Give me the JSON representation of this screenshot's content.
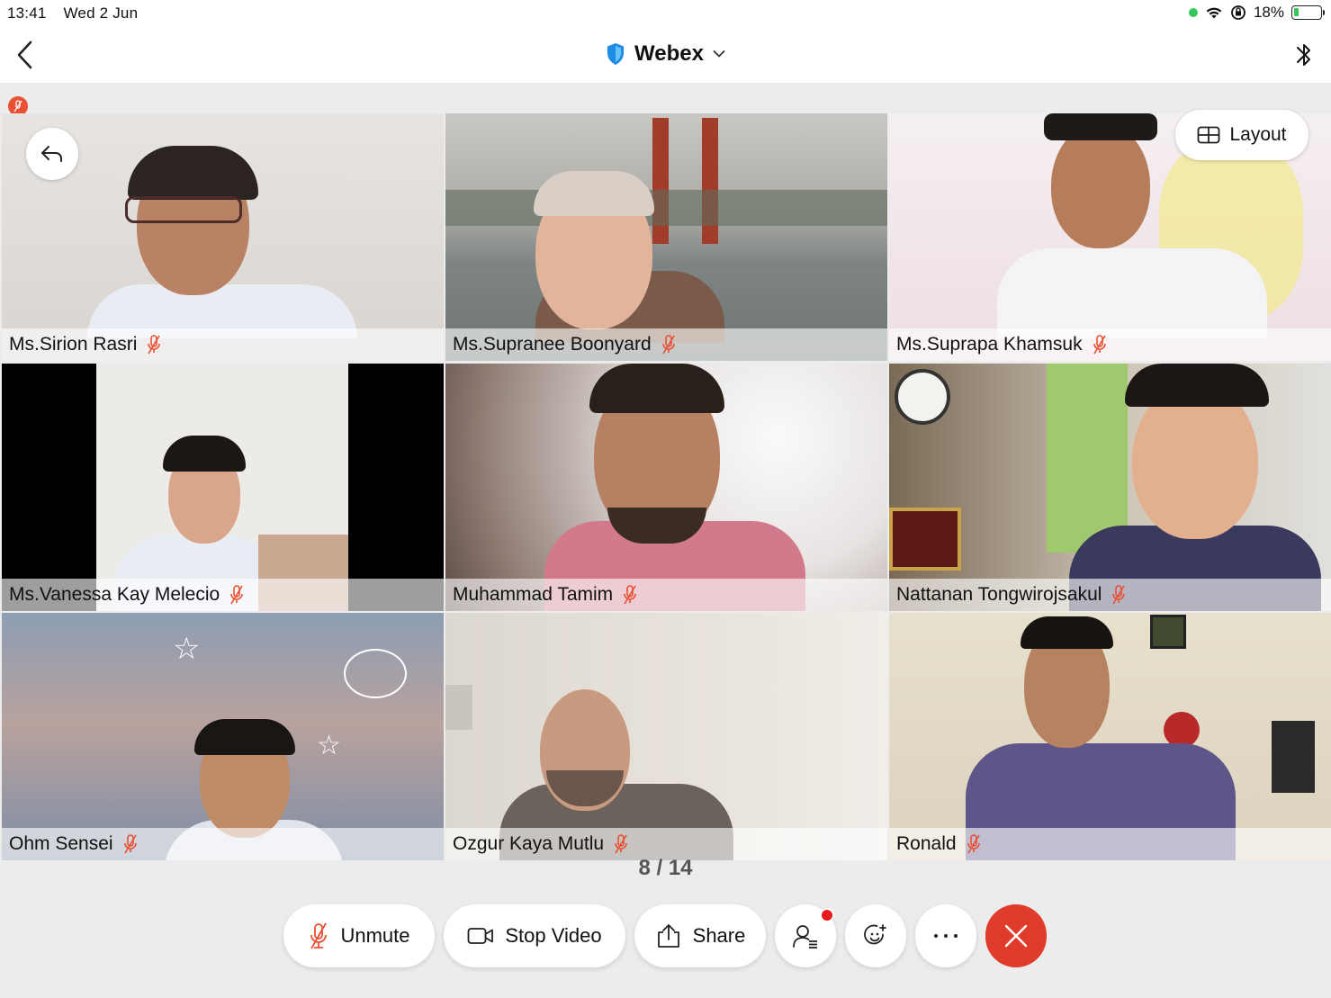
{
  "status_bar": {
    "time": "13:41",
    "date": "Wed 2 Jun",
    "battery": "18%",
    "battery_level": 0.18
  },
  "nav": {
    "title": "Webex",
    "icons": [
      "back-chevron-icon",
      "shield-icon",
      "chevron-down-icon",
      "bluetooth-icon"
    ]
  },
  "grid": {
    "layout_label": "Layout",
    "page_indicator": "8 / 14",
    "participants": [
      {
        "name": "Ms.Sirion Rasri",
        "muted": true
      },
      {
        "name": "Ms.Supranee Boonyard",
        "muted": true
      },
      {
        "name": "Ms.Suprapa Khamsuk",
        "muted": true
      },
      {
        "name": "Ms.Vanessa Kay Melecio",
        "muted": true
      },
      {
        "name": "Muhammad Tamim",
        "muted": true
      },
      {
        "name": "Nattanan Tongwirojsakul",
        "muted": true
      },
      {
        "name": "Ohm Sensei",
        "muted": true
      },
      {
        "name": "Ozgur Kaya Mutlu",
        "muted": true
      },
      {
        "name": "Ronald",
        "muted": true
      }
    ]
  },
  "controls": {
    "unmute": "Unmute",
    "stop_video": "Stop Video",
    "share": "Share"
  },
  "colors": {
    "end_call": "#e13b2b",
    "mute_icon": "#ea5033",
    "notification": "#e81c1c",
    "shield": "#1f8de6"
  }
}
